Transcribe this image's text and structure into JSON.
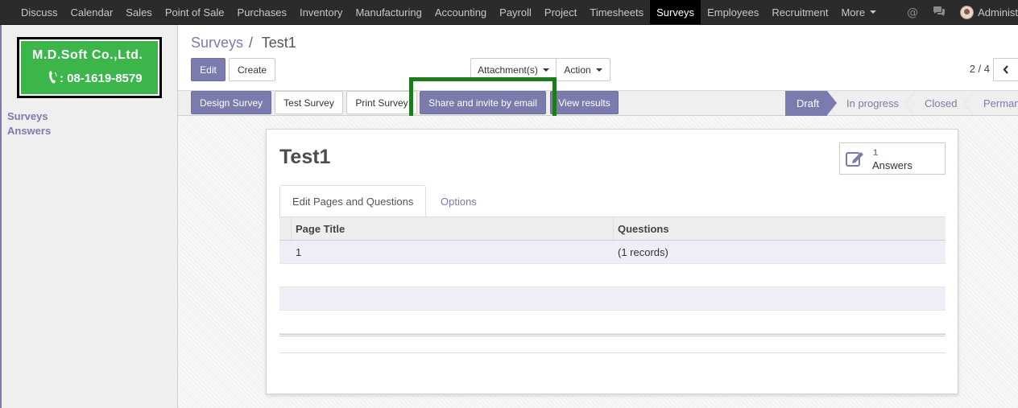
{
  "topnav": {
    "items": [
      "Discuss",
      "Calendar",
      "Sales",
      "Point of Sale",
      "Purchases",
      "Inventory",
      "Manufacturing",
      "Accounting",
      "Payroll",
      "Project",
      "Timesheets",
      "Surveys",
      "Employees",
      "Recruitment"
    ],
    "more_label": "More",
    "active": "Surveys",
    "user_name": "Administ",
    "icons": [
      "at-icon",
      "chat-icon"
    ]
  },
  "sidebar": {
    "logo_title": "M.D.Soft Co.,Ltd.",
    "logo_phone": ": 08-1619-8579",
    "links": [
      "Surveys",
      "Answers"
    ]
  },
  "control": {
    "breadcrumb_parent": "Surveys",
    "breadcrumb_sep": "/",
    "breadcrumb_current": "Test1",
    "edit_label": "Edit",
    "create_label": "Create",
    "attachments_label": "Attachment(s)",
    "action_label": "Action",
    "pager": "2 / 4"
  },
  "header": {
    "design_label": "Design Survey",
    "test_label": "Test Survey",
    "print_label": "Print Survey",
    "share_label": "Share and invite by email",
    "results_label": "View results",
    "stages": [
      "Draft",
      "In progress",
      "Closed",
      "Perman"
    ],
    "active_stage": "Draft"
  },
  "form": {
    "title": "Test1",
    "stat_count": "1",
    "stat_label": "Answers",
    "tabs": [
      "Edit Pages and Questions",
      "Options"
    ],
    "table": {
      "columns": [
        "Page Title",
        "Questions"
      ],
      "rows": [
        [
          "1",
          "(1 records)"
        ]
      ]
    }
  },
  "colors": {
    "accent": "#7c7bad",
    "topbar": "#2b2b2b",
    "highlight": "#1d7a1d",
    "logo_green": "#3cb54a"
  }
}
